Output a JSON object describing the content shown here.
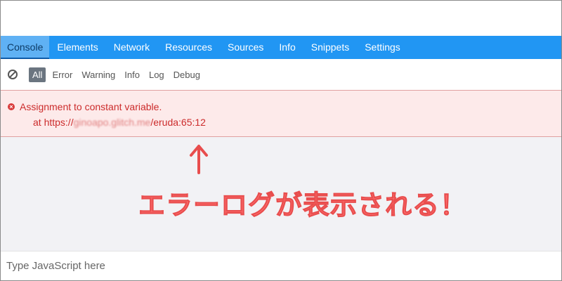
{
  "tabs": [
    {
      "label": "Console",
      "active": true
    },
    {
      "label": "Elements"
    },
    {
      "label": "Network"
    },
    {
      "label": "Resources"
    },
    {
      "label": "Sources"
    },
    {
      "label": "Info"
    },
    {
      "label": "Snippets"
    },
    {
      "label": "Settings"
    }
  ],
  "filters": [
    {
      "label": "All",
      "active": true
    },
    {
      "label": "Error"
    },
    {
      "label": "Warning"
    },
    {
      "label": "Info"
    },
    {
      "label": "Log"
    },
    {
      "label": "Debug"
    }
  ],
  "error": {
    "message": "Assignment to constant variable.",
    "stack_prefix": "at https://",
    "stack_redacted": "ginoapo.glitch.me",
    "stack_suffix": "/eruda:65:12"
  },
  "annotation": {
    "text": "エラーログが表示される！",
    "arrow": "↑"
  },
  "console_input": {
    "placeholder": "Type JavaScript here"
  },
  "colors": {
    "tabbar": "#2196f3",
    "error_text": "#cc2b2b",
    "error_bg": "#fdeaea",
    "annotation": "#ff6f6f"
  }
}
